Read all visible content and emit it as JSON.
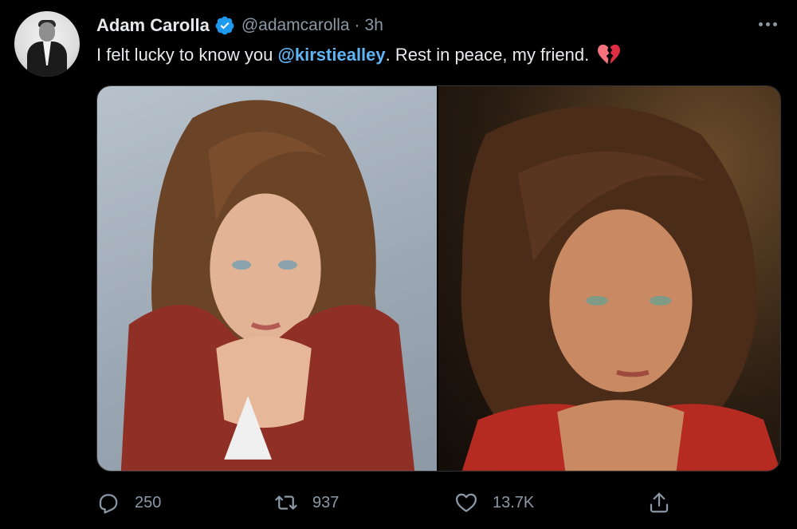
{
  "tweet": {
    "author_name": "Adam Carolla",
    "handle": "@adamcarolla",
    "separator": "·",
    "time": "3h",
    "text_before": "I felt lucky to know you ",
    "mention": "@kirstiealley",
    "text_after": ". Rest in peace, my friend.",
    "emoji": "broken-heart"
  },
  "icons": {
    "verified": "verified-badge-icon",
    "more": "more-options-icon",
    "reply": "reply-icon",
    "retweet": "retweet-icon",
    "like": "heart-icon",
    "share": "share-icon"
  },
  "metrics": {
    "replies": "250",
    "retweets": "937",
    "likes": "13.7K"
  },
  "colors": {
    "background": "#000000",
    "text": "#e7e9ea",
    "secondary": "#8b98a5",
    "accent": "#1d9bf0",
    "mention": "#60b5f5",
    "heart": "#f4737f"
  }
}
